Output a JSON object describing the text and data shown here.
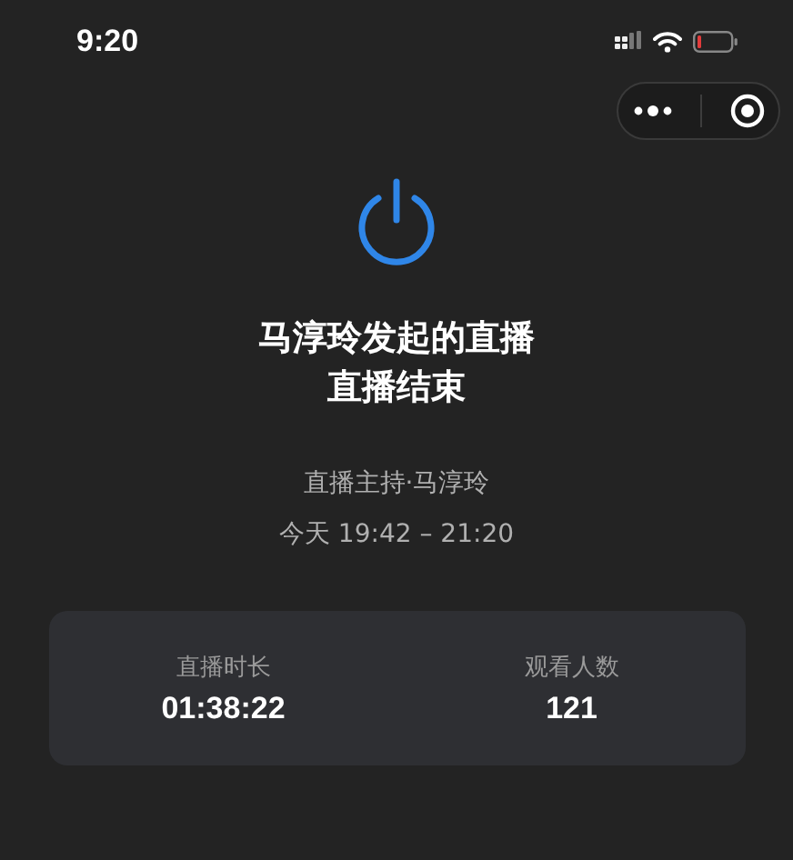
{
  "status_bar": {
    "time": "9:20"
  },
  "title": "马淳玲发起的直播",
  "status": "直播结束",
  "host": "直播主持·马淳玲",
  "time_range": "今天 19:42 – 21:20",
  "stats": [
    {
      "label": "直播时长",
      "value": "01:38:22"
    },
    {
      "label": "观看人数",
      "value": "121"
    }
  ]
}
